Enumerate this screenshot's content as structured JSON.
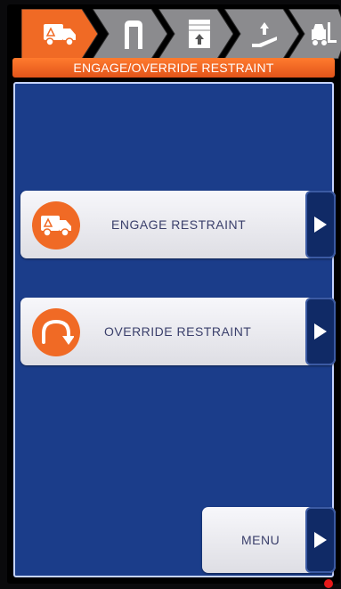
{
  "tabs": [
    {
      "name": "truck-icon",
      "active": true
    },
    {
      "name": "restraint-icon",
      "active": false
    },
    {
      "name": "door-icon",
      "active": false
    },
    {
      "name": "leveler-icon",
      "active": false
    },
    {
      "name": "forklift-icon",
      "active": false
    }
  ],
  "header": {
    "title": "ENGAGE/OVERRIDE RESTRAINT"
  },
  "buttons": {
    "engage": {
      "label": "ENGAGE RESTRAINT",
      "icon": "truck-icon"
    },
    "override": {
      "label": "OVERRIDE RESTRAINT",
      "icon": "curved-arrow-icon"
    },
    "menu": {
      "label": "MENU"
    }
  },
  "colors": {
    "accent": "#f06a25",
    "panel": "#1b3d8a",
    "tab": "#8b8b8e",
    "status": "#e81919"
  }
}
